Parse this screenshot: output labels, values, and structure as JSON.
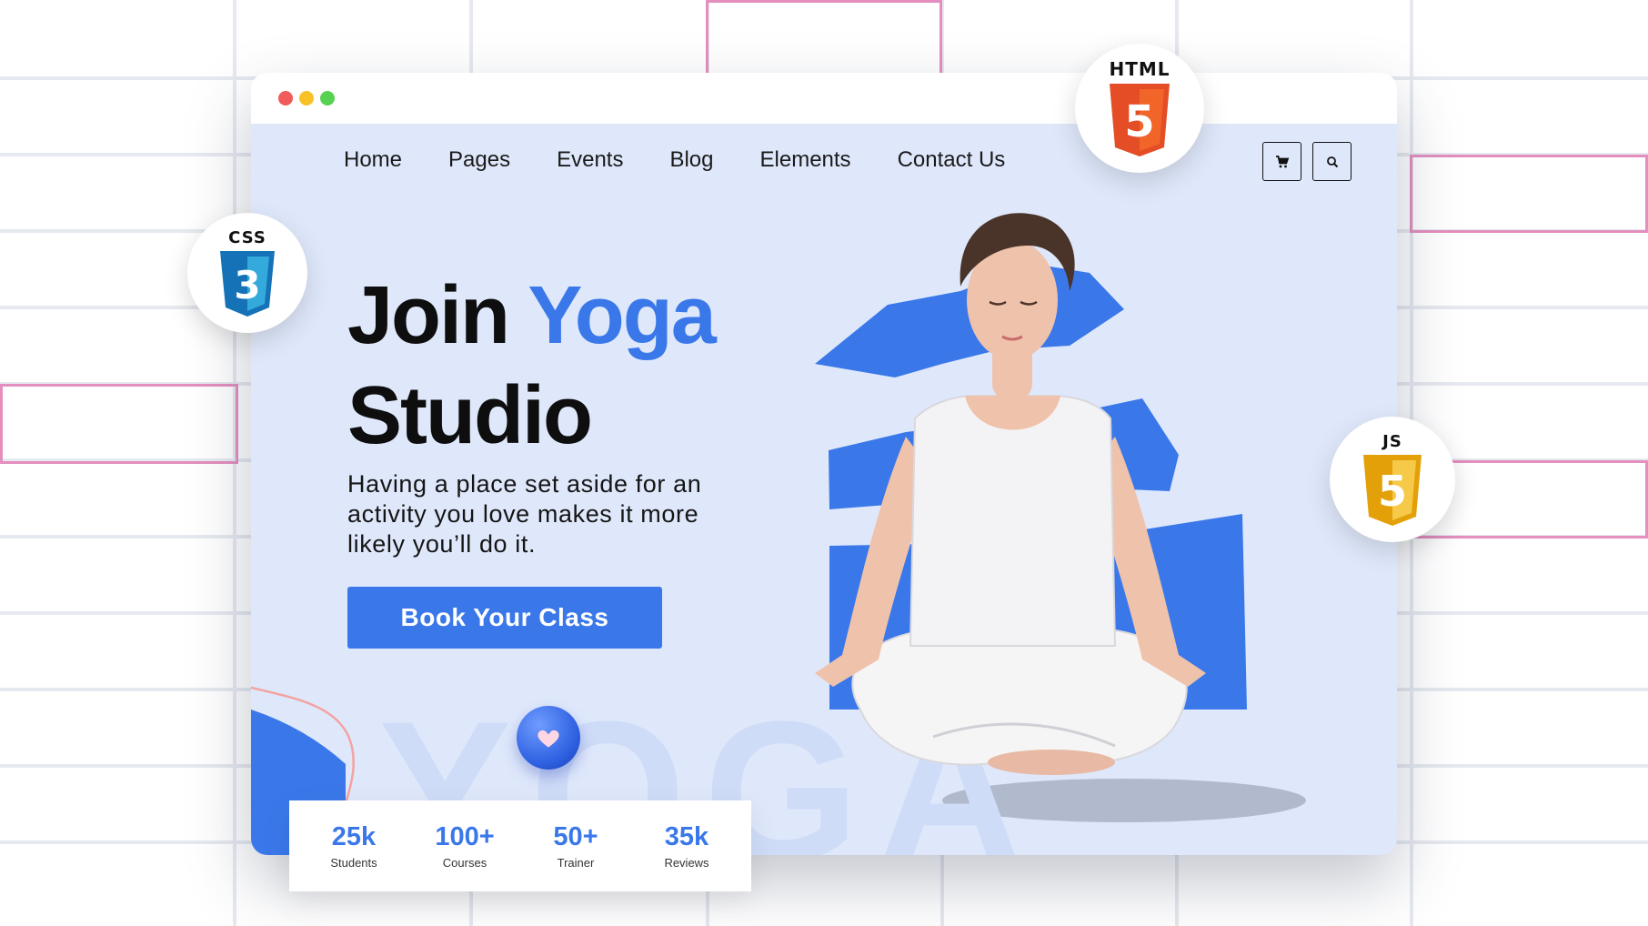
{
  "window": {
    "controls": [
      "close",
      "minimize",
      "maximize"
    ]
  },
  "nav": {
    "items": [
      {
        "label": "Home"
      },
      {
        "label": "Pages"
      },
      {
        "label": "Events"
      },
      {
        "label": "Blog"
      },
      {
        "label": "Elements"
      },
      {
        "label": "Contact Us"
      }
    ],
    "cart_icon": "cart-icon",
    "search_icon": "search-icon"
  },
  "hero": {
    "title_part1": "Join ",
    "title_accent": "Yoga",
    "title_line2": "Studio",
    "description": "Having a place set aside for an activity you love makes it more likely you’ll do it.",
    "cta_label": "Book Your Class",
    "watermark": "YOGA"
  },
  "stats": [
    {
      "value": "25k",
      "label": "Students"
    },
    {
      "value": "100+",
      "label": "Courses"
    },
    {
      "value": "50+",
      "label": "Trainer"
    },
    {
      "value": "35k",
      "label": "Reviews"
    }
  ],
  "badges": {
    "html": {
      "label": "HTML",
      "digit": "5",
      "color": "#e44d26"
    },
    "css": {
      "label": "CSS",
      "digit": "3",
      "color": "#1572b6"
    },
    "js": {
      "label": "JS",
      "digit": "5",
      "color": "#f0a81c"
    }
  },
  "colors": {
    "accent": "#3a78ea",
    "page_bg": "#dfe8fb"
  }
}
